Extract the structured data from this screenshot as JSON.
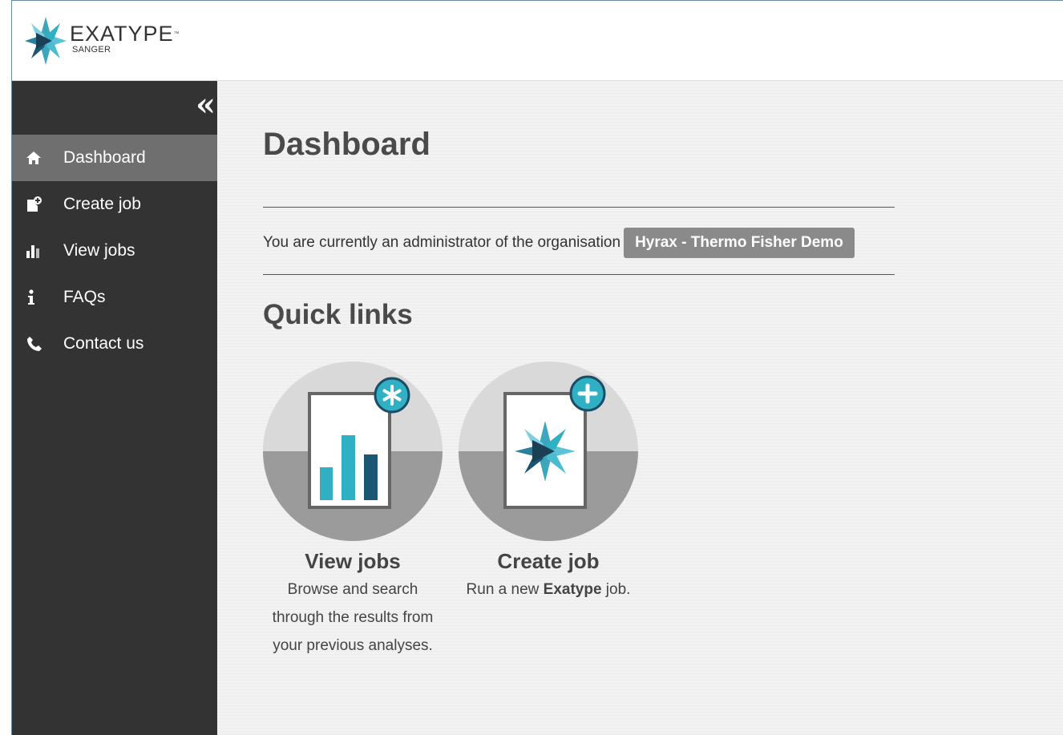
{
  "app": {
    "logo_name": "EXATYPE",
    "logo_tm": "™",
    "logo_sub": "SANGER"
  },
  "sidebar": {
    "collapse_icon": "double-chevron-left-icon",
    "collapse_glyph": "«",
    "items": [
      {
        "label": "Dashboard",
        "icon": "home-icon",
        "active": true
      },
      {
        "label": "Create job",
        "icon": "create-job-icon",
        "active": false
      },
      {
        "label": "View jobs",
        "icon": "bar-chart-icon",
        "active": false
      },
      {
        "label": "FAQs",
        "icon": "info-icon",
        "active": false
      },
      {
        "label": "Contact us",
        "icon": "phone-icon",
        "active": false
      }
    ]
  },
  "main": {
    "title": "Dashboard",
    "admin_text": "You are currently an administrator of the organisation",
    "org_name": "Hyrax - Thermo Fisher Demo",
    "quick_links_title": "Quick links",
    "quick_links": [
      {
        "title": "View jobs",
        "description": "Browse and search through the results from your previous analyses."
      },
      {
        "title": "Create job",
        "desc_before": "Run a new ",
        "desc_bold": "Exatype",
        "desc_after": " job."
      }
    ]
  },
  "colors": {
    "sidebar_bg": "#333333",
    "sidebar_active": "#6f6f6f",
    "accent_teal": "#2fb0c4",
    "accent_dark_teal": "#1b5672",
    "badge_bg": "#8a8a8a"
  }
}
